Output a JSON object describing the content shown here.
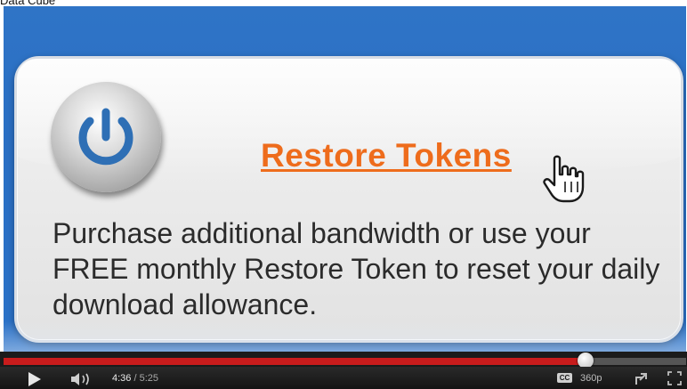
{
  "page_title_fragment": "Data Cube",
  "slide": {
    "link_text": "Restore Tokens",
    "description": "Purchase additional bandwidth or use your FREE monthly Restore Token to reset your daily download allowance."
  },
  "player": {
    "current_time": "4:36",
    "duration": " / 5:25",
    "progress_fraction": 0.849,
    "cc_label": "CC",
    "quality_label": "360p"
  },
  "colors": {
    "link": "#ee6c1c",
    "background_blue": "#2f74c6",
    "progress_red": "#c81c1c",
    "power_icon_blue": "#2e6fb5"
  },
  "icons": [
    "power-icon",
    "hand-pointer-icon",
    "play-icon",
    "volume-icon",
    "popout-icon",
    "fullscreen-icon"
  ]
}
